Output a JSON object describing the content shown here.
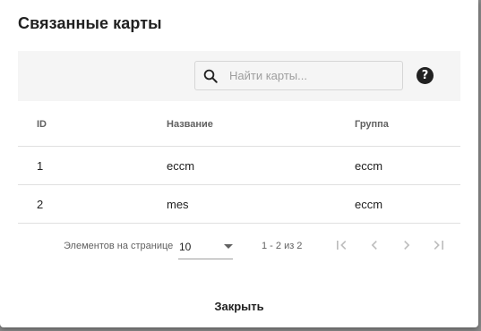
{
  "dialog": {
    "title": "Связанные карты",
    "close_label": "Закрыть"
  },
  "search": {
    "placeholder": "Найти карты...",
    "value": "",
    "icon": "search-icon",
    "help_icon": "help-icon",
    "help_glyph": "?"
  },
  "table": {
    "columns": [
      "ID",
      "Название",
      "Группа"
    ],
    "rows": [
      {
        "id": "1",
        "name": "eccm",
        "group": "eccm"
      },
      {
        "id": "2",
        "name": "mes",
        "group": "eccm"
      }
    ]
  },
  "paginator": {
    "page_size_label": "Элементов на странице",
    "page_size": "10",
    "range_label": "1 - 2 из 2"
  },
  "colors": {
    "toolbar_bg": "#f5f5f5",
    "text": "#212121",
    "muted_text": "#616161",
    "disabled_icon": "#bdbdbd"
  }
}
